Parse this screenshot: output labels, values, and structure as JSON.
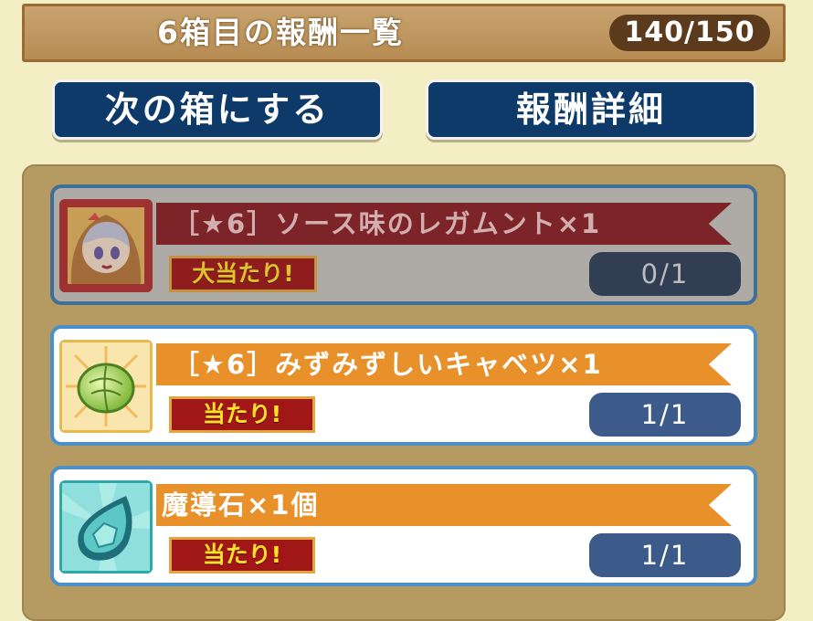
{
  "header": {
    "title": "6箱目の報酬一覧",
    "counter": "140/150"
  },
  "buttons": {
    "next_box": "次の箱にする",
    "reward_details": "報酬詳細"
  },
  "rewards": [
    {
      "name": "［★6］ソース味のレガムント×1",
      "tag": "大当たり!",
      "progress": "0/1",
      "icon": "character-portrait-icon",
      "ribbon_color": "#8a1f24",
      "claimed": false
    },
    {
      "name": "［★6］みずみずしいキャベツ×1",
      "tag": "当たり!",
      "progress": "1/1",
      "icon": "cabbage-icon",
      "ribbon_color": "#e8902a",
      "claimed": true
    },
    {
      "name": "魔導石×1個",
      "tag": "当たり!",
      "progress": "1/1",
      "icon": "magic-stone-icon",
      "ribbon_color": "#e8902a",
      "claimed": true
    }
  ]
}
